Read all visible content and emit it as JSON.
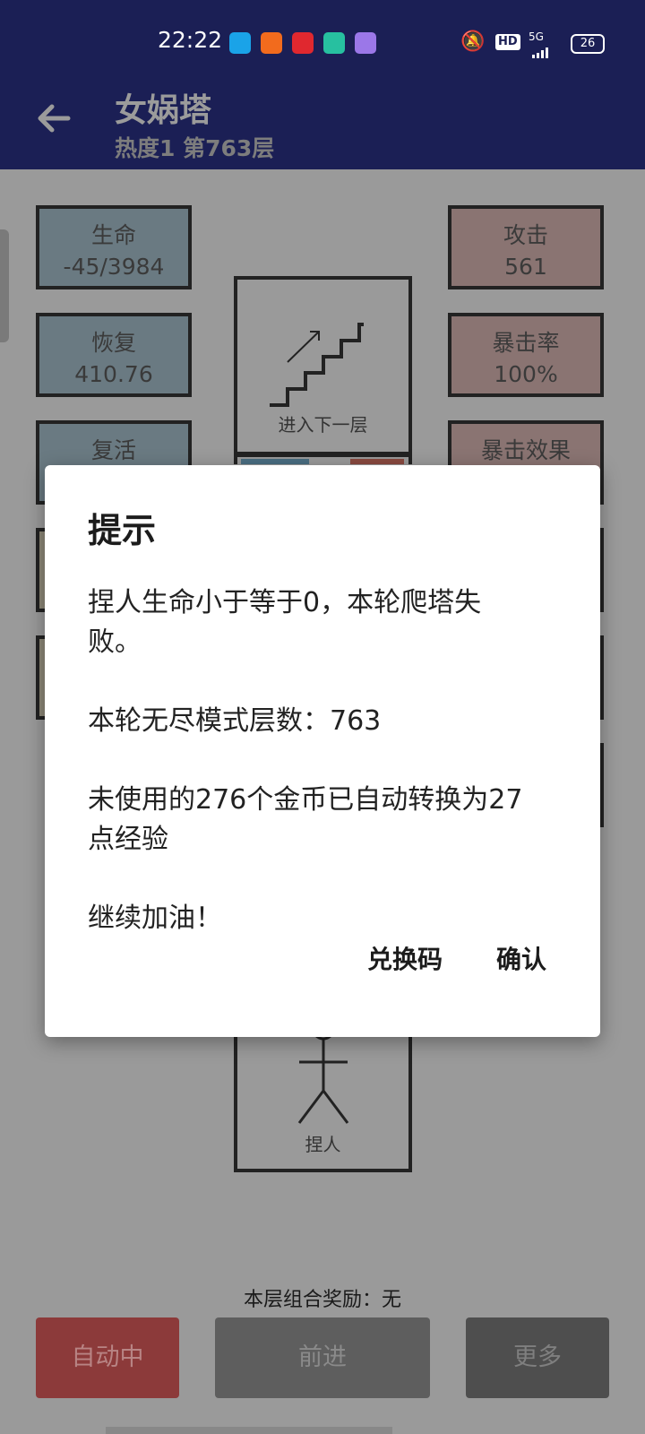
{
  "status_bar": {
    "time": "22:22",
    "battery": "26",
    "network": "5G",
    "hd": "HD",
    "icons": [
      "qq-icon",
      "kuaishou-icon",
      "netease-music-icon",
      "tencent-video-icon",
      "taobao-icon"
    ]
  },
  "app_bar": {
    "title": "女娲塔",
    "subtitle": "热度1 第763层"
  },
  "stats_left": [
    {
      "label": "生命",
      "value": "-45/3984"
    },
    {
      "label": "恢复",
      "value": "410.76"
    },
    {
      "label": "复活",
      "value": ""
    }
  ],
  "stats_right": [
    {
      "label": "攻击",
      "value": "561"
    },
    {
      "label": "暴击率",
      "value": "100%"
    },
    {
      "label": "暴击效果",
      "value": ""
    }
  ],
  "next_floor": {
    "label": "进入下一层"
  },
  "character": {
    "label": "捏人"
  },
  "combo_reward": "本层组合奖励：无",
  "bottom_buttons": {
    "auto": "自动中",
    "forward": "前进",
    "more": "更多"
  },
  "dialog": {
    "title": "提示",
    "message": "捏人生命小于等于0，本轮爬塔失\n败。\n\n本轮无尽模式层数：763\n\n未使用的276个金币已自动转换为27\n点经验\n\n继续加油！",
    "redeem_label": "兑换码",
    "confirm_label": "确认"
  },
  "colors": {
    "app_bar": "#1b1f55",
    "scrim": "#9a9a9a",
    "auto_button": "#8c3a3a",
    "stat_blue": "#6a7a82",
    "stat_red": "#8a7472"
  }
}
